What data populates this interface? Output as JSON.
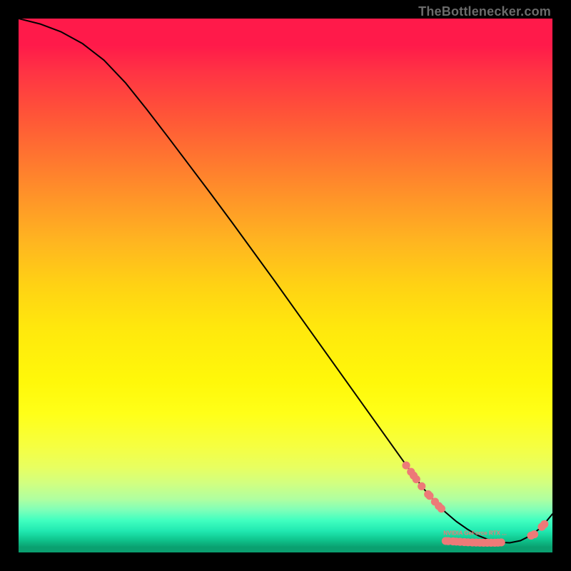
{
  "attribution": "TheBottlenecker.com",
  "chart_data": {
    "type": "line",
    "title": "",
    "xlabel": "",
    "ylabel": "",
    "xlim": [
      0,
      100
    ],
    "ylim": [
      0,
      100
    ],
    "series": [
      {
        "name": "curve",
        "x": [
          0,
          4,
          8,
          12,
          16,
          20,
          24,
          28,
          32,
          36,
          40,
          44,
          48,
          52,
          56,
          60,
          64,
          68,
          72,
          74,
          76,
          78,
          80,
          82,
          84,
          86,
          88,
          90,
          92,
          94,
          96,
          98,
          100
        ],
        "y": [
          100,
          99,
          97.5,
          95.3,
          92.2,
          88,
          83,
          77.8,
          72.5,
          67.2,
          61.8,
          56.3,
          50.8,
          45.2,
          39.6,
          34,
          28.4,
          22.8,
          17.2,
          14.4,
          11.8,
          9.5,
          7.5,
          5.8,
          4.4,
          3.2,
          2.4,
          1.9,
          1.8,
          2.2,
          3.2,
          4.8,
          7.2
        ]
      }
    ],
    "markers": [
      {
        "x": 72.6,
        "y": 16.3
      },
      {
        "x": 73.5,
        "y": 15.1
      },
      {
        "x": 74.0,
        "y": 14.4
      },
      {
        "x": 74.5,
        "y": 13.7
      },
      {
        "x": 75.5,
        "y": 12.4
      },
      {
        "x": 76.7,
        "y": 10.9
      },
      {
        "x": 77.0,
        "y": 10.6
      },
      {
        "x": 78.0,
        "y": 9.5
      },
      {
        "x": 78.7,
        "y": 8.7
      },
      {
        "x": 79.2,
        "y": 8.2
      },
      {
        "x": 80.0,
        "y": 2.15
      },
      {
        "x": 80.5,
        "y": 2.12
      },
      {
        "x": 81.4,
        "y": 2.07
      },
      {
        "x": 82.0,
        "y": 2.03
      },
      {
        "x": 82.7,
        "y": 1.99
      },
      {
        "x": 83.5,
        "y": 1.94
      },
      {
        "x": 84.2,
        "y": 1.9
      },
      {
        "x": 85.0,
        "y": 1.87
      },
      {
        "x": 85.7,
        "y": 1.85
      },
      {
        "x": 86.4,
        "y": 1.83
      },
      {
        "x": 87.1,
        "y": 1.82
      },
      {
        "x": 87.8,
        "y": 1.82
      },
      {
        "x": 88.5,
        "y": 1.82
      },
      {
        "x": 89.2,
        "y": 1.82
      },
      {
        "x": 89.8,
        "y": 1.84
      },
      {
        "x": 90.4,
        "y": 1.88
      },
      {
        "x": 96.0,
        "y": 3.15
      },
      {
        "x": 96.6,
        "y": 3.4
      },
      {
        "x": 98.0,
        "y": 4.8
      },
      {
        "x": 98.5,
        "y": 5.3
      }
    ],
    "marker_color": "#ed7a78",
    "marker_radius": 5.6,
    "line_color": "#000000",
    "line_width": 2,
    "annotation": {
      "text": "NVIDIA GeForce RTX ...",
      "x": 85.5,
      "y": 3.3,
      "color": "#ed7a78"
    }
  }
}
